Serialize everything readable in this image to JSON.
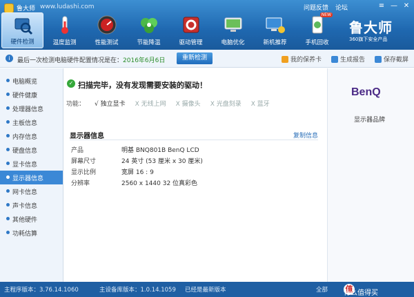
{
  "window": {
    "title": "鲁大师",
    "url": "www.ludashi.com"
  },
  "top_links": [
    "问题反馈",
    "论坛"
  ],
  "window_controls": [
    "≡",
    "—",
    "✕"
  ],
  "nav": [
    {
      "label": "硬件检测",
      "icon": "hardware-icon",
      "active": true
    },
    {
      "label": "温度监测",
      "icon": "thermometer-icon"
    },
    {
      "label": "性能测试",
      "icon": "speedometer-icon"
    },
    {
      "label": "节能降温",
      "icon": "leaf-icon"
    },
    {
      "label": "驱动管理",
      "icon": "driver-icon"
    },
    {
      "label": "电脑优化",
      "icon": "optimize-icon"
    },
    {
      "label": "新机推荐",
      "icon": "monitor-icon"
    },
    {
      "label": "手机回收",
      "icon": "phone-icon",
      "badge": "NEW"
    }
  ],
  "brand": {
    "name": "鲁大师",
    "sub": "360旗下安全产品"
  },
  "infobar": {
    "text": "最后一次检测电脑硬件配置情况是在：",
    "date": "2016年6月6日",
    "recheck": "重新检测",
    "links": [
      "我的保养卡",
      "生成报告",
      "保存截屏"
    ]
  },
  "sidebar": [
    "电脑概览",
    "硬件健康",
    "处理器信息",
    "主板信息",
    "内存信息",
    "硬盘信息",
    "显卡信息",
    "显示器信息",
    "网卡信息",
    "声卡信息",
    "其他硬件",
    "功耗估算"
  ],
  "sidebar_active": 7,
  "main": {
    "scan_message": "扫描完毕，没有发现需要安装的驱动！",
    "features_label": "功能：",
    "features": [
      {
        "text": "√ 独立显卡",
        "on": true
      },
      {
        "text": "X 无线上网",
        "on": false
      },
      {
        "text": "X 摄像头",
        "on": false
      },
      {
        "text": "X 光盘刻录",
        "on": false
      },
      {
        "text": "X 蓝牙",
        "on": false
      }
    ],
    "section_title": "显示器信息",
    "copy_link": "复制信息",
    "specs": [
      {
        "label": "产品",
        "value": "明基 BNQ801B BenQ LCD"
      },
      {
        "label": "屏幕尺寸",
        "value": "24 英寸 (53 厘米 x 30 厘米)"
      },
      {
        "label": "显示比例",
        "value": "宽屏 16 : 9"
      },
      {
        "label": "分辨率",
        "value": "2560 x 1440 32 位真彩色"
      }
    ]
  },
  "right_panel": {
    "logo": "BenQ",
    "caption": "显示器品牌"
  },
  "footer": {
    "version": "主程序版本：3.76.14.1060",
    "db_version": "主设备库版本：1.0.14.1059",
    "status": "已经是最新版本",
    "watermark": "什么值得买",
    "partial": "全部"
  }
}
